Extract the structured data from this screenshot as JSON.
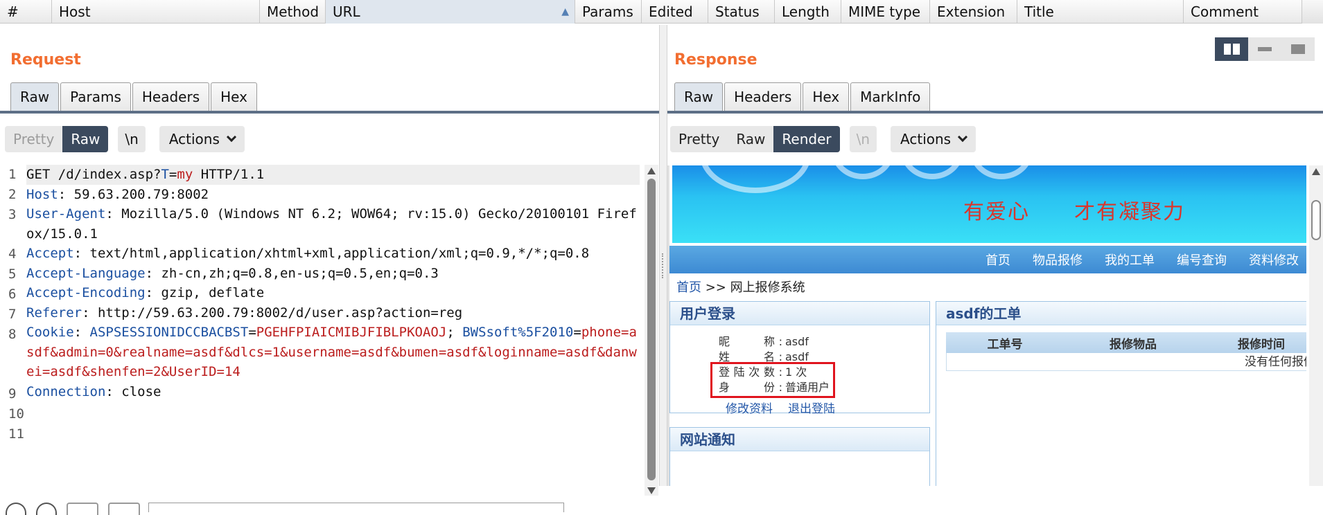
{
  "history_columns": [
    {
      "label": "#",
      "w": 75
    },
    {
      "label": "Host",
      "w": 300
    },
    {
      "label": "Method",
      "w": 95
    },
    {
      "label": "URL",
      "w": 360
    },
    {
      "label": "Params",
      "w": 96
    },
    {
      "label": "Edited",
      "w": 96
    },
    {
      "label": "Status",
      "w": 96
    },
    {
      "label": "Length",
      "w": 96
    },
    {
      "label": "MIME type",
      "w": 128
    },
    {
      "label": "Extension",
      "w": 126
    },
    {
      "label": "Title",
      "w": 240
    },
    {
      "label": "Comment",
      "w": 171
    }
  ],
  "request": {
    "title": "Request",
    "tabs": [
      "Raw",
      "Params",
      "Headers",
      "Hex"
    ],
    "view": {
      "pretty": "Pretty",
      "raw": "Raw",
      "newline": "\\n",
      "actions": "Actions"
    },
    "lines": [
      {
        "n": "1",
        "parts": [
          {
            "t": "GET /d/index.asp?",
            "c": ""
          },
          {
            "t": "T",
            "c": "hk"
          },
          {
            "t": "=",
            "c": ""
          },
          {
            "t": "my",
            "c": "hv"
          },
          {
            "t": " HTTP/1.1",
            "c": ""
          }
        ]
      },
      {
        "n": "2",
        "parts": [
          {
            "t": "Host",
            "c": "hk"
          },
          {
            "t": ": 59.63.200.79:8002",
            "c": ""
          }
        ]
      },
      {
        "n": "3",
        "parts": [
          {
            "t": "User-Agent",
            "c": "hk"
          },
          {
            "t": ": Mozilla/5.0 (Windows NT 6.2; WOW64; rv:15.0) Gecko/20100101 Firefox/15.0.1",
            "c": ""
          }
        ]
      },
      {
        "n": "4",
        "parts": [
          {
            "t": "Accept",
            "c": "hk"
          },
          {
            "t": ": text/html,application/xhtml+xml,application/xml;q=0.9,*/*;q=0.8",
            "c": ""
          }
        ]
      },
      {
        "n": "5",
        "parts": [
          {
            "t": "Accept-Language",
            "c": "hk"
          },
          {
            "t": ": zh-cn,zh;q=0.8,en-us;q=0.5,en;q=0.3",
            "c": ""
          }
        ]
      },
      {
        "n": "6",
        "parts": [
          {
            "t": "Accept-Encoding",
            "c": "hk"
          },
          {
            "t": ": gzip, deflate",
            "c": ""
          }
        ]
      },
      {
        "n": "7",
        "parts": [
          {
            "t": "Referer",
            "c": "hk"
          },
          {
            "t": ": http://59.63.200.79:8002/d/user.asp?action=reg",
            "c": ""
          }
        ]
      },
      {
        "n": "8",
        "parts": [
          {
            "t": "Cookie",
            "c": "hk"
          },
          {
            "t": ": ",
            "c": ""
          },
          {
            "t": "ASPSESSIONIDCCBACBST",
            "c": "hk"
          },
          {
            "t": "=",
            "c": ""
          },
          {
            "t": "PGEHFPIAICMIBJFIBLPKOAOJ",
            "c": "hv"
          },
          {
            "t": "; ",
            "c": ""
          },
          {
            "t": "BWSsoft%5F2010",
            "c": "hk"
          },
          {
            "t": "=",
            "c": ""
          },
          {
            "t": "phone=asdf&admin=0&realname=asdf&dlcs=1&username=asdf&bumen=asdf&loginname=asdf&danwei=asdf&shenfen=2&UserID=14",
            "c": "hv"
          }
        ]
      },
      {
        "n": "9",
        "parts": [
          {
            "t": "Connection",
            "c": "hk"
          },
          {
            "t": ": close",
            "c": ""
          }
        ]
      },
      {
        "n": "10",
        "parts": [
          {
            "t": "",
            "c": ""
          }
        ]
      },
      {
        "n": "11",
        "parts": [
          {
            "t": "",
            "c": ""
          }
        ]
      }
    ]
  },
  "response": {
    "title": "Response",
    "tabs": [
      "Raw",
      "Headers",
      "Hex",
      "MarkInfo"
    ],
    "view": {
      "pretty": "Pretty",
      "raw": "Raw",
      "render": "Render",
      "newline": "\\n",
      "actions": "Actions"
    },
    "page": {
      "slogan": "有爱心　　才有凝聚力",
      "nav": [
        "首页",
        "物品报修",
        "我的工单",
        "编号查询",
        "资料修改"
      ],
      "crumb_link": "首页",
      "crumb_rest": " >> 网上报修系统",
      "login_title": "用户登录",
      "login_info": [
        {
          "k": "昵　　称:",
          "v": "asdf"
        },
        {
          "k": "姓　　名:",
          "v": "asdf"
        },
        {
          "k": "登陆次数:",
          "v": "1 次"
        },
        {
          "k": "身　　份:",
          "v": "普通用户"
        }
      ],
      "links": [
        "修改资料",
        "退出登陆"
      ],
      "notice_title": "网站通知",
      "orders_title": "asdf的工单",
      "orders_headers": [
        "工单号",
        "报修物品",
        "报修时间"
      ],
      "orders_empty": "没有任何报修"
    }
  }
}
